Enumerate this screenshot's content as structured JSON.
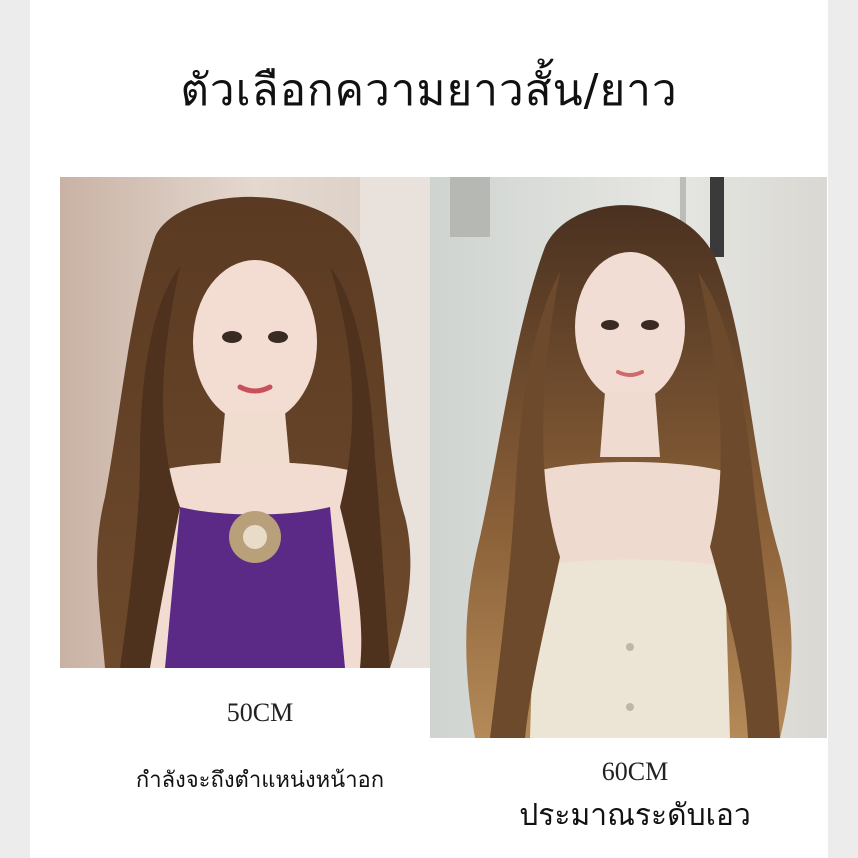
{
  "title": "ตัวเลือกความยาวสั้น/ยาว",
  "options": [
    {
      "length": "50CM",
      "description": "กำลังจะถึงตำแหน่งหน้าอก",
      "image_alt": "long wavy brown wig, purple top"
    },
    {
      "length": "60CM",
      "description": "ประมาณระดับเอว",
      "image_alt": "long wavy highlighted wig, cream top"
    }
  ]
}
